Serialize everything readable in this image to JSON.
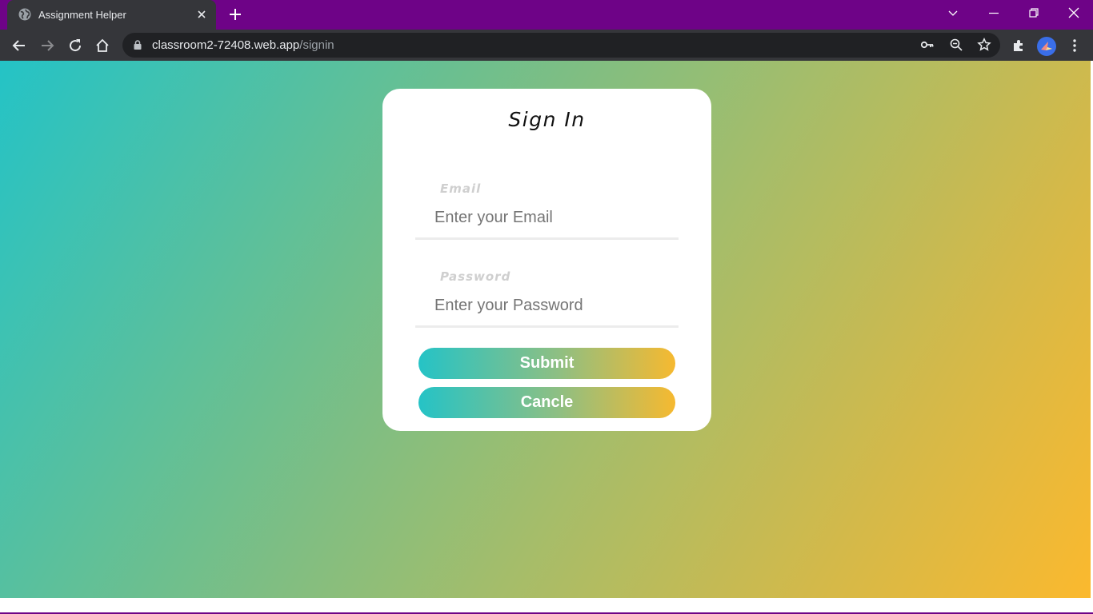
{
  "browser": {
    "tab_title": "Assignment Helper",
    "url_host": "classroom2-72408.web.app",
    "url_path": "/signin",
    "colors": {
      "tabbar": "#6e0387",
      "toolbar": "#35363a",
      "omnibox": "#202124"
    }
  },
  "page": {
    "background_gradient": [
      "#24c3c6",
      "#fbb92e"
    ],
    "signin": {
      "title": "Sign In",
      "email_label": "Email",
      "email_placeholder": "Enter your Email",
      "email_value": "",
      "password_label": "Password",
      "password_placeholder": "Enter your Password",
      "password_value": "",
      "submit_label": "Submit",
      "cancel_label": "Cancle"
    }
  }
}
